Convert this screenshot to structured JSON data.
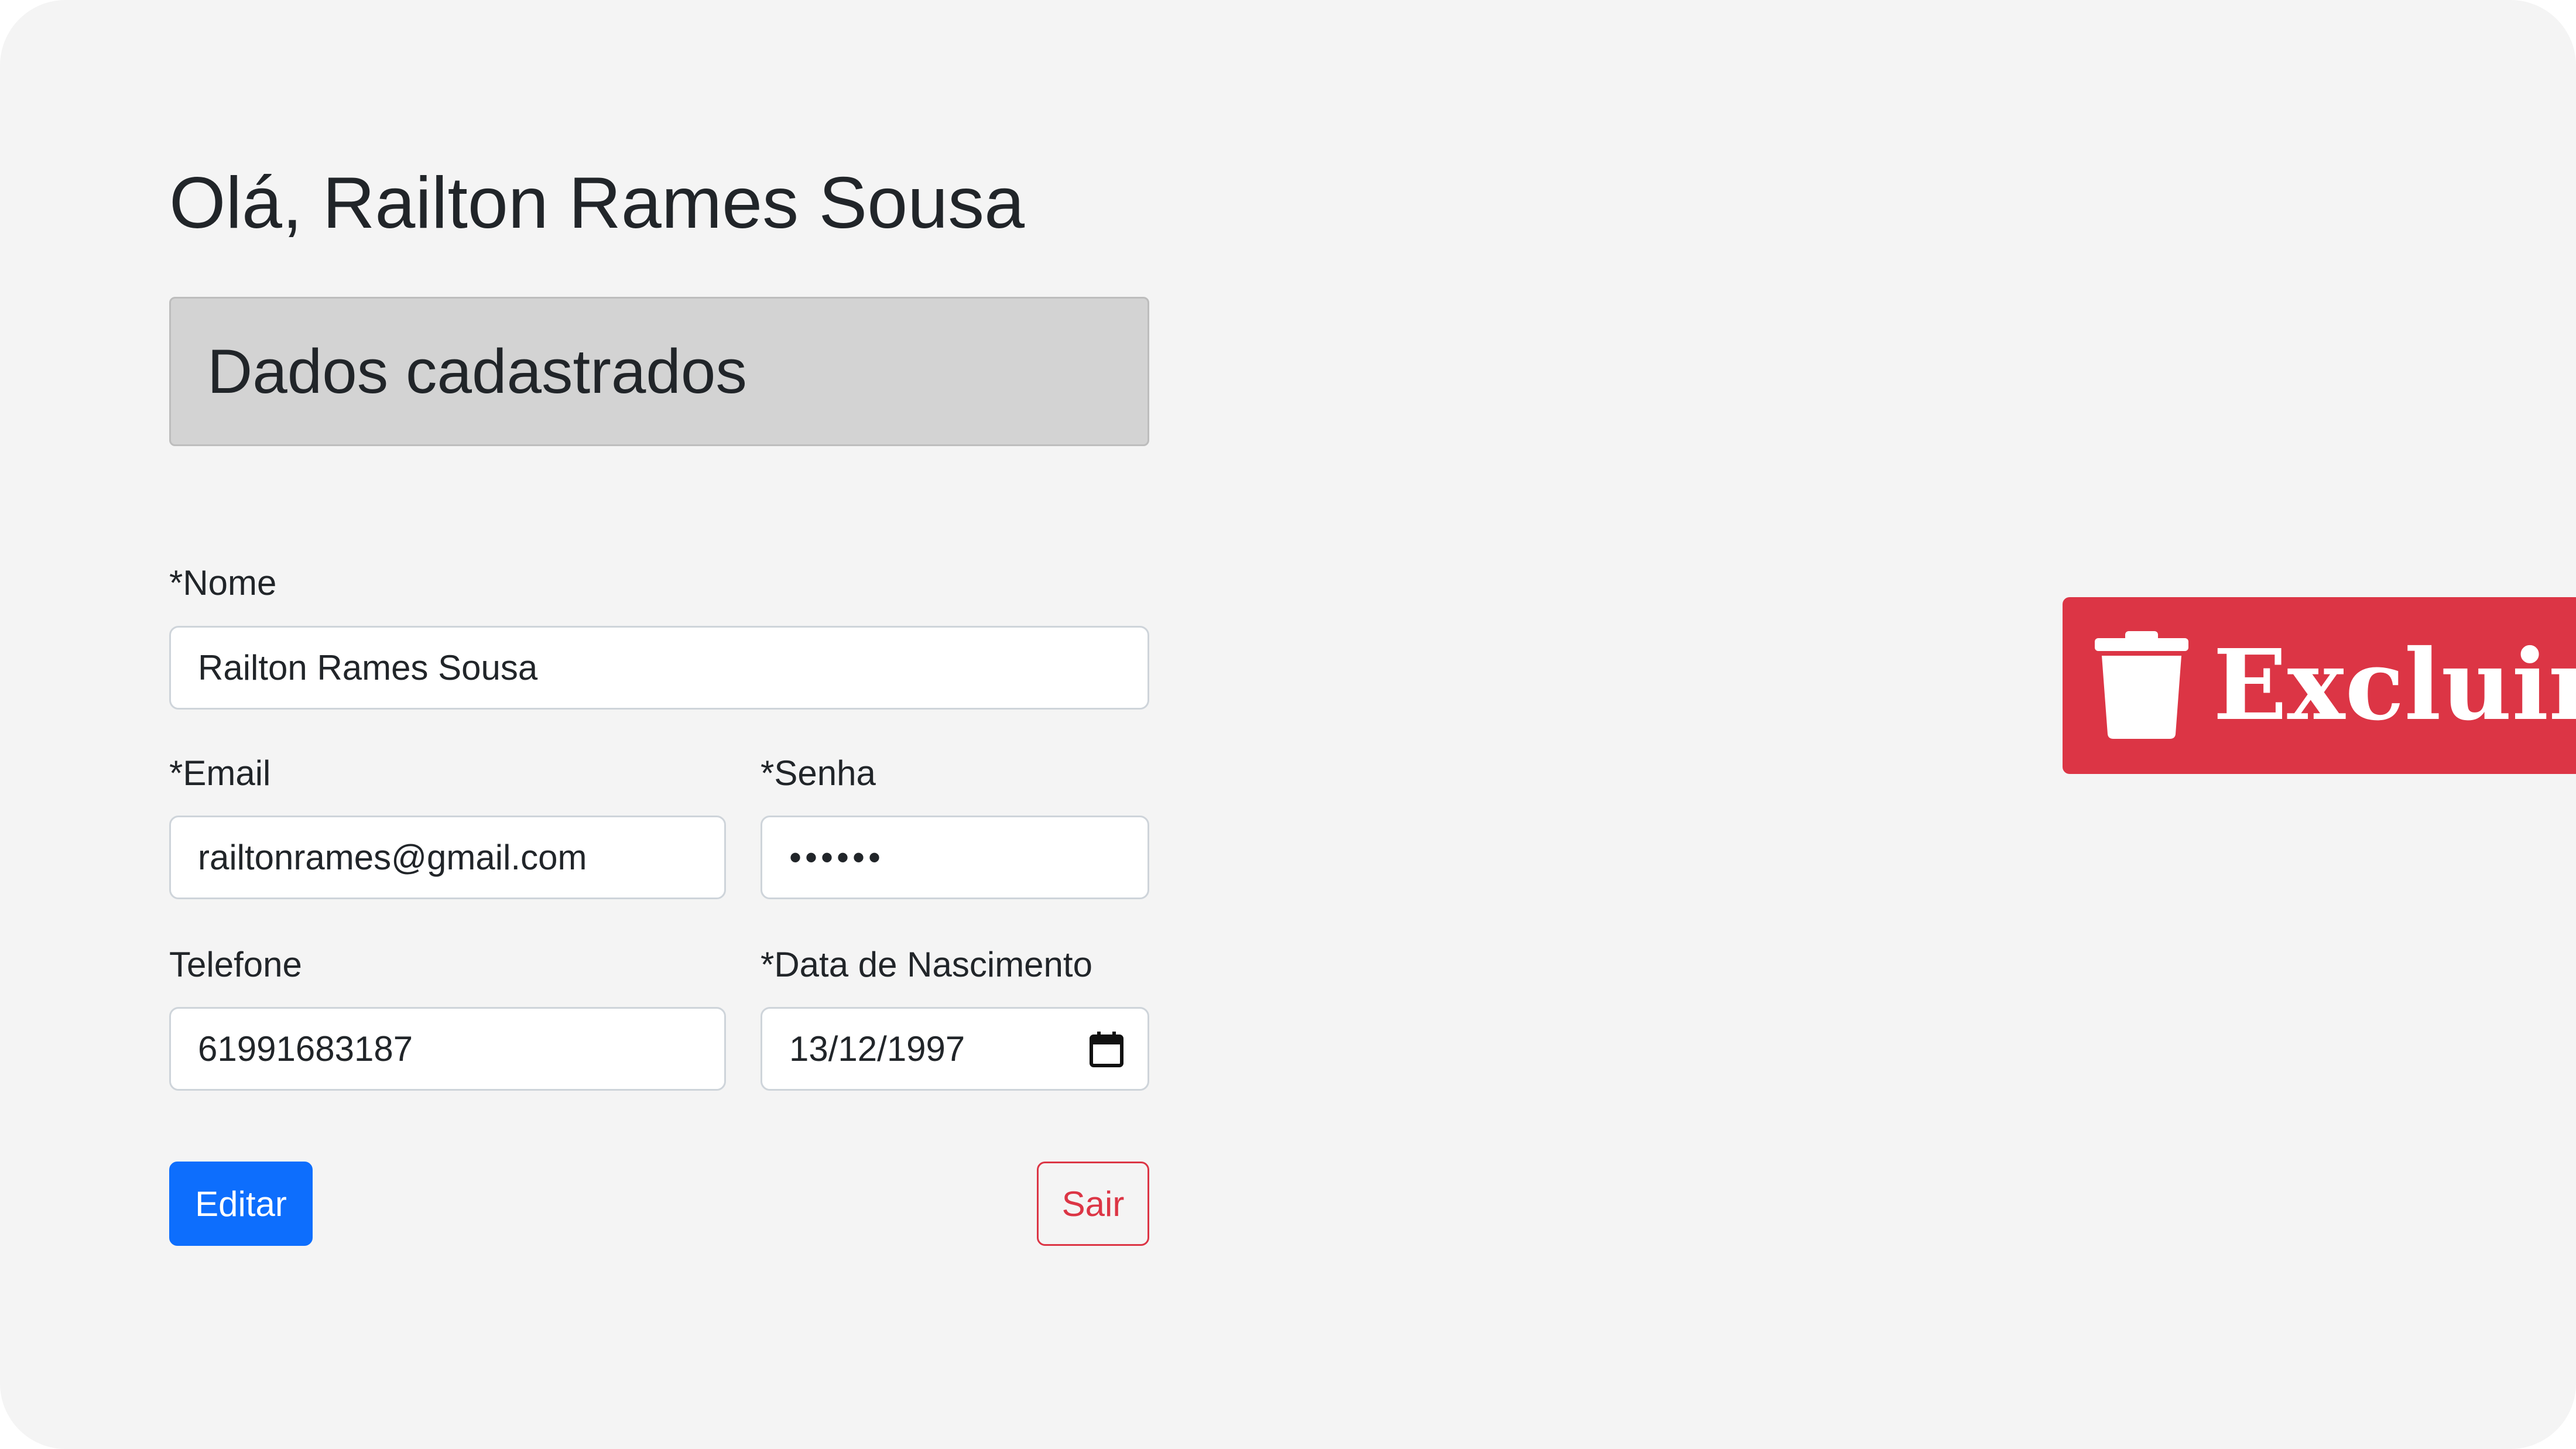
{
  "greeting": "Olá, Railton Rames Sousa",
  "section_title": "Dados cadastrados",
  "form": {
    "nome": {
      "label": "*Nome",
      "value": "Railton Rames Sousa"
    },
    "email": {
      "label": "*Email",
      "value": "railtonrames@gmail.com"
    },
    "senha": {
      "label": "*Senha",
      "value": "••••••"
    },
    "telefone": {
      "label": "Telefone",
      "value": "61991683187"
    },
    "data_nascimento": {
      "label": "*Data de Nascimento",
      "value": "13/12/1997"
    }
  },
  "actions": {
    "edit_label": "Editar",
    "exit_label": "Sair",
    "delete_label": "Excluir"
  },
  "icons": {
    "delete": "trash-icon",
    "date_picker": "calendar-icon"
  },
  "colors": {
    "primary": "#0d6efd",
    "danger": "#dc3545",
    "background": "#f4f4f4",
    "section_header": "#d3d3d3"
  }
}
